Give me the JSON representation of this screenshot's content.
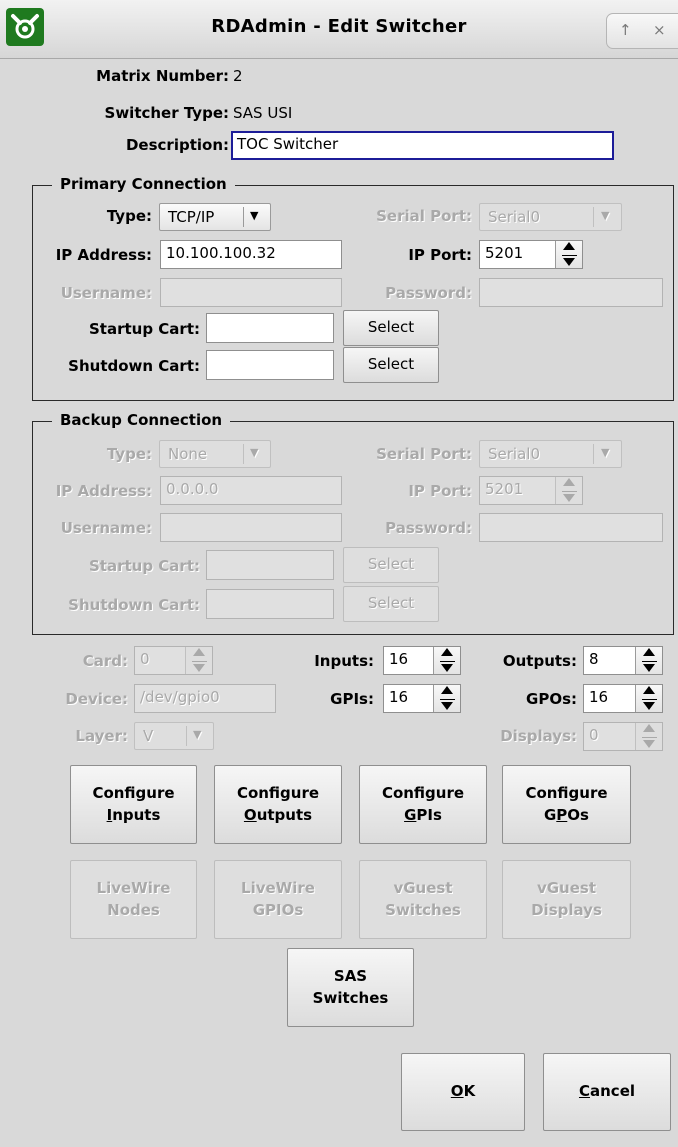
{
  "window": {
    "title": "RDAdmin - Edit Switcher",
    "controls": [
      "↑",
      "×"
    ]
  },
  "info": {
    "matrix_number_label": "Matrix Number:",
    "matrix_number": "2",
    "switcher_type_label": "Switcher Type:",
    "switcher_type": "SAS USI",
    "description_label": "Description:",
    "description": "TOC Switcher"
  },
  "primary": {
    "title": "Primary Connection",
    "type_label": "Type:",
    "type_value": "TCP/IP",
    "serial_port_label": "Serial Port:",
    "serial_port_value": "Serial0",
    "ip_address_label": "IP Address:",
    "ip_address": "10.100.100.32",
    "ip_port_label": "IP Port:",
    "ip_port": "5201",
    "username_label": "Username:",
    "username": "",
    "password_label": "Password:",
    "password": "",
    "startup_cart_label": "Startup Cart:",
    "startup_cart": "",
    "shutdown_cart_label": "Shutdown Cart:",
    "shutdown_cart": "",
    "select_label": "Select"
  },
  "backup": {
    "title": "Backup Connection",
    "type_label": "Type:",
    "type_value": "None",
    "serial_port_label": "Serial Port:",
    "serial_port_value": "Serial0",
    "ip_address_label": "IP Address:",
    "ip_address": "0.0.0.0",
    "ip_port_label": "IP Port:",
    "ip_port": "5201",
    "username_label": "Username:",
    "username": "",
    "password_label": "Password:",
    "password": "",
    "startup_cart_label": "Startup Cart:",
    "startup_cart": "",
    "shutdown_cart_label": "Shutdown Cart:",
    "shutdown_cart": "",
    "select_label": "Select"
  },
  "settings": {
    "card_label": "Card:",
    "card": "0",
    "inputs_label": "Inputs:",
    "inputs": "16",
    "outputs_label": "Outputs:",
    "outputs": "8",
    "device_label": "Device:",
    "device": "/dev/gpio0",
    "gpis_label": "GPIs:",
    "gpis": "16",
    "gpos_label": "GPOs:",
    "gpos": "16",
    "layer_label": "Layer:",
    "layer": "V",
    "displays_label": "Displays:",
    "displays": "0"
  },
  "buttons": {
    "configure": "Configure",
    "inputs_mnemonic": "I",
    "inputs_rest": "nputs",
    "outputs_mnemonic": "O",
    "outputs_rest": "utputs",
    "gpis_mnemonic": "G",
    "gpis_rest": "PIs",
    "gpos_pre": "G",
    "gpos_mnemonic": "P",
    "gpos_rest": "Os",
    "livewire_nodes": [
      "LiveWire",
      "Nodes"
    ],
    "livewire_gpios": [
      "LiveWire",
      "GPIOs"
    ],
    "vguest_switches": [
      "vGuest",
      "Switches"
    ],
    "vguest_displays": [
      "vGuest",
      "Displays"
    ],
    "sas_switches": [
      "SAS",
      "Switches"
    ],
    "ok_mnemonic": "O",
    "ok_rest": "K",
    "cancel_mnemonic": "C",
    "cancel_rest": "ancel"
  },
  "colors": {
    "window_bg": "#d9d9d9",
    "focus_border": "#1c1c98",
    "disabled_text": "#a9a9a9"
  }
}
